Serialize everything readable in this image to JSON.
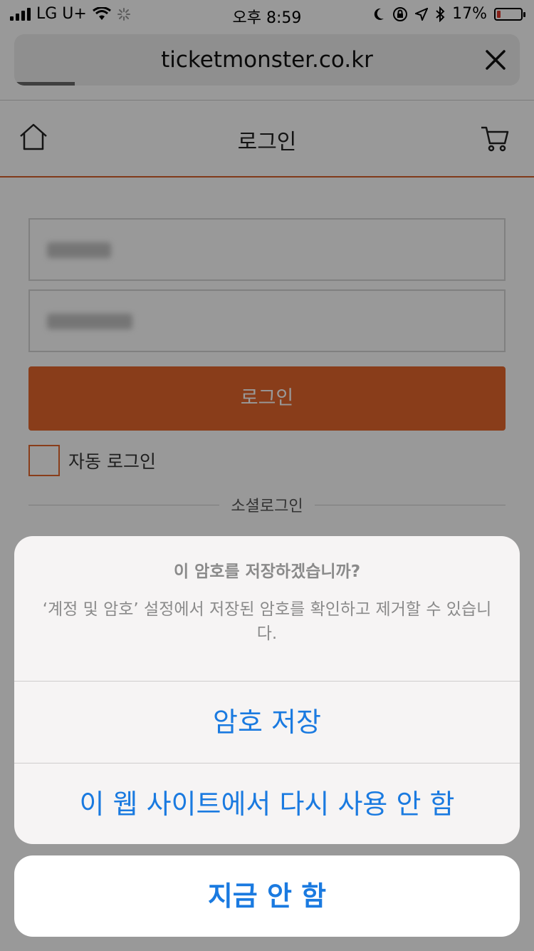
{
  "status_bar": {
    "carrier": "LG U+",
    "time": "오후 8:59",
    "battery": "17%",
    "battery_level": 0.17
  },
  "browser": {
    "url": "ticketmonster.co.kr",
    "load_progress": 0.12
  },
  "header": {
    "title": "로그인"
  },
  "form": {
    "login_button": "로그인",
    "auto_login_label": "자동 로그인",
    "social_login_label": "소셜로그인"
  },
  "action_sheet": {
    "title": "이 암호를 저장하겠습니까?",
    "message": "‘계정 및 암호’ 설정에서 저장된 암호를 확인하고 제거할 수 있습니다.",
    "save_button": "암호 저장",
    "never_button": "이 웹 사이트에서 다시 사용 안 함",
    "cancel_button": "지금 안 함"
  },
  "colors": {
    "accent": "#e4662c",
    "ios_blue": "#1a7ae0"
  }
}
